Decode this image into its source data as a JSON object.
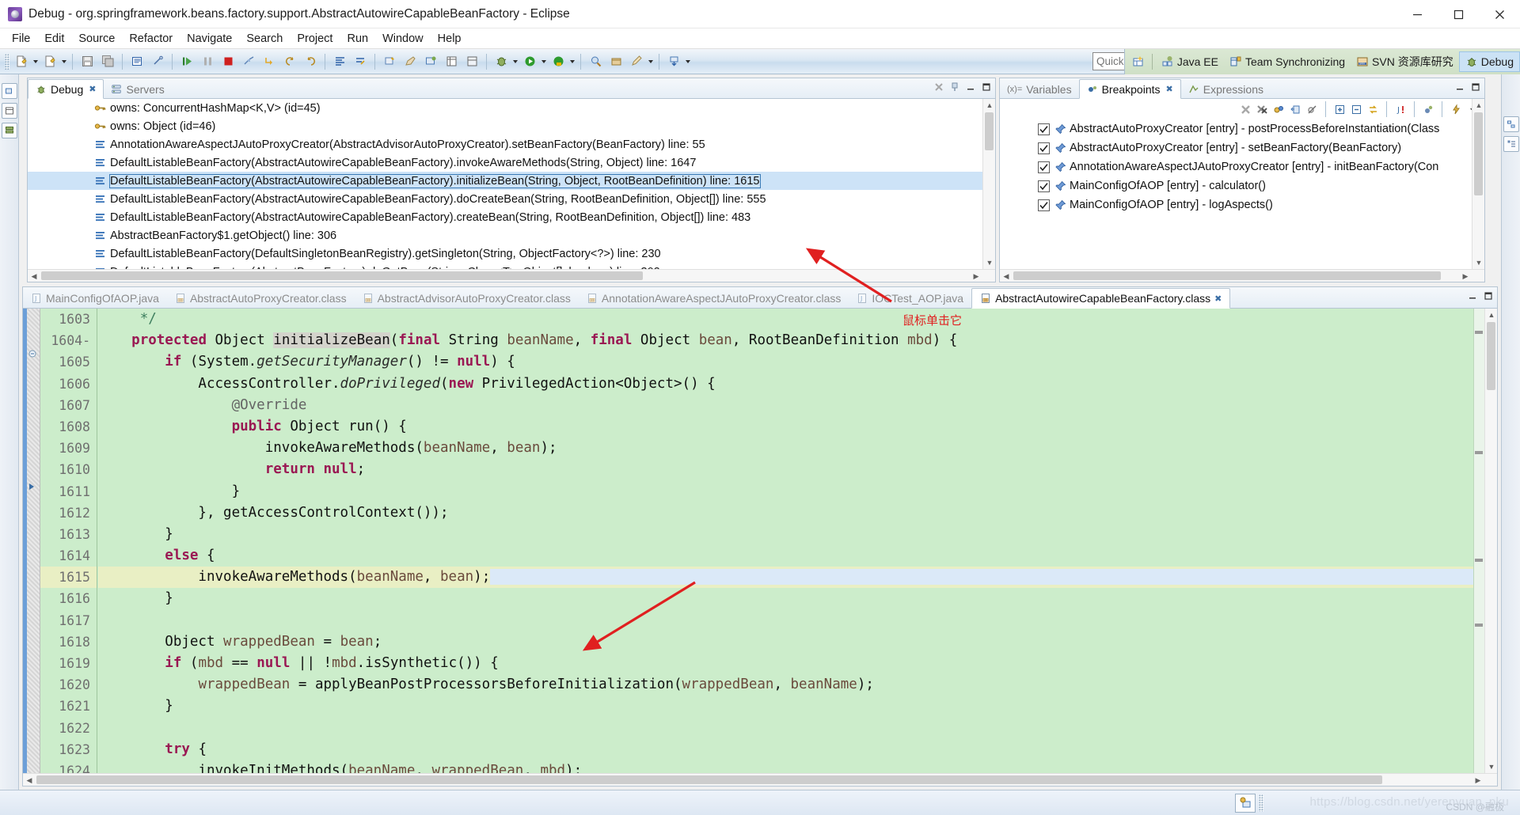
{
  "window": {
    "title": "Debug - org.springframework.beans.factory.support.AbstractAutowireCapableBeanFactory - Eclipse",
    "app_icon": "eclipse-icon",
    "minimize": "–",
    "maximize": "❐",
    "close": "✕"
  },
  "menubar": {
    "items": [
      "File",
      "Edit",
      "Source",
      "Refactor",
      "Navigate",
      "Search",
      "Project",
      "Run",
      "Window",
      "Help"
    ]
  },
  "toolbar": {
    "quick_access_placeholder": "Quick Access",
    "icons": [
      "new-file-icon",
      "new-wizard-icon",
      "save-icon",
      "save-all-icon",
      "print-icon",
      "link-icon",
      "resume-icon",
      "suspend-icon",
      "terminate-icon",
      "disconnect-icon",
      "step-return-icon",
      "step-into-icon",
      "step-over-icon",
      "align-icon",
      "skip-breakpoints-icon",
      "open-type-icon",
      "last-edit-icon",
      "external-tools-icon",
      "table-icon",
      "table2-icon",
      "debug-icon",
      "run-icon",
      "run-as-icon",
      "coverage-icon",
      "search-icon",
      "package-icon",
      "edit-icon",
      "download-icon"
    ]
  },
  "perspectives": {
    "open_perspective_icon": "open-perspective-icon",
    "items": [
      {
        "label": "Java EE",
        "icon": "javaee-perspective-icon",
        "active": false
      },
      {
        "label": "Team Synchronizing",
        "icon": "team-sync-perspective-icon",
        "active": false
      },
      {
        "label": "SVN 资源库研究",
        "icon": "svn-perspective-icon",
        "active": false
      },
      {
        "label": "Debug",
        "icon": "debug-perspective-icon",
        "active": true
      }
    ]
  },
  "debug_view": {
    "tabs": [
      {
        "label": "Debug",
        "icon": "debug-icon",
        "active": true,
        "closable": true
      },
      {
        "label": "Servers",
        "icon": "servers-icon",
        "active": false,
        "closable": false
      }
    ],
    "toolbar_icons": [
      "remove-all-terminated-icon",
      "pin-icon",
      "minimize-icon",
      "maximize-icon"
    ],
    "stack": [
      {
        "icon": "monitor-key-icon",
        "text": "owns: ConcurrentHashMap<K,V>  (id=45)",
        "selected": false
      },
      {
        "icon": "monitor-key-icon",
        "text": "owns: Object  (id=46)",
        "selected": false
      },
      {
        "icon": "stack-frame-icon",
        "text": "AnnotationAwareAspectJAutoProxyCreator(AbstractAdvisorAutoProxyCreator).setBeanFactory(BeanFactory) line: 55",
        "selected": false
      },
      {
        "icon": "stack-frame-icon",
        "text": "DefaultListableBeanFactory(AbstractAutowireCapableBeanFactory).invokeAwareMethods(String, Object) line: 1647",
        "selected": false
      },
      {
        "icon": "stack-frame-icon",
        "text": "DefaultListableBeanFactory(AbstractAutowireCapableBeanFactory).initializeBean(String, Object, RootBeanDefinition) line: 1615",
        "selected": true
      },
      {
        "icon": "stack-frame-icon",
        "text": "DefaultListableBeanFactory(AbstractAutowireCapableBeanFactory).doCreateBean(String, RootBeanDefinition, Object[]) line: 555",
        "selected": false
      },
      {
        "icon": "stack-frame-icon",
        "text": "DefaultListableBeanFactory(AbstractAutowireCapableBeanFactory).createBean(String, RootBeanDefinition, Object[]) line: 483",
        "selected": false
      },
      {
        "icon": "stack-frame-icon",
        "text": "AbstractBeanFactory$1.getObject() line: 306",
        "selected": false
      },
      {
        "icon": "stack-frame-icon",
        "text": "DefaultListableBeanFactory(DefaultSingletonBeanRegistry).getSingleton(String, ObjectFactory<?>) line: 230",
        "selected": false
      },
      {
        "icon": "stack-frame-icon",
        "text": "DefaultListableBeanFactory(AbstractBeanFactory).doGetBean(String, Class<T>, Object[], boolean) line: 302",
        "selected": false
      }
    ]
  },
  "breakpoints_view": {
    "tabs": [
      {
        "label": "Variables",
        "icon": "variables-icon",
        "active": false,
        "closable": false
      },
      {
        "label": "Breakpoints",
        "icon": "breakpoints-icon",
        "active": true,
        "closable": true
      },
      {
        "label": "Expressions",
        "icon": "expressions-icon",
        "active": false,
        "closable": false
      }
    ],
    "toolbar_icons": [
      "remove-breakpoint-icon",
      "remove-all-breakpoints-icon",
      "link-with-debug-view-icon",
      "goto-file-icon",
      "skip-all-breakpoints-icon",
      "expand-all-icon",
      "collapse-all-icon",
      "working-sets-icon",
      "add-java-exception-icon",
      "breakpoint-group-icon",
      "thunder-icon",
      "view-menu-icon"
    ],
    "minimize": "minimize-icon",
    "maximize": "maximize-icon",
    "items": [
      {
        "checked": true,
        "icon": "breakpoint-pin-icon",
        "text": "AbstractAutoProxyCreator [entry] - postProcessBeforeInstantiation(Class"
      },
      {
        "checked": true,
        "icon": "breakpoint-pin-icon",
        "text": "AbstractAutoProxyCreator [entry] - setBeanFactory(BeanFactory)"
      },
      {
        "checked": true,
        "icon": "breakpoint-pin-icon",
        "text": "AnnotationAwareAspectJAutoProxyCreator [entry] - initBeanFactory(Con"
      },
      {
        "checked": true,
        "icon": "breakpoint-pin-icon",
        "text": "MainConfigOfAOP [entry] - calculator()"
      },
      {
        "checked": true,
        "icon": "breakpoint-pin-icon",
        "text": "MainConfigOfAOP [entry] - logAspects()"
      }
    ]
  },
  "editor": {
    "tabs": [
      {
        "label": "MainConfigOfAOP.java",
        "icon": "java-file-icon",
        "active": false,
        "closable": false
      },
      {
        "label": "AbstractAutoProxyCreator.class",
        "icon": "class-file-icon",
        "active": false,
        "closable": false
      },
      {
        "label": "AbstractAdvisorAutoProxyCreator.class",
        "icon": "class-file-icon",
        "active": false,
        "closable": false
      },
      {
        "label": "AnnotationAwareAspectJAutoProxyCreator.class",
        "icon": "class-file-icon",
        "active": false,
        "closable": false
      },
      {
        "label": "IOCTest_AOP.java",
        "icon": "java-file-icon",
        "active": false,
        "closable": false
      },
      {
        "label": "AbstractAutowireCapableBeanFactory.class",
        "icon": "class-file-icon",
        "active": true,
        "closable": true
      }
    ],
    "minimize": "minimize-icon",
    "maximize": "maximize-icon",
    "first_line_number": 1603,
    "current_line_number": 1615,
    "code_lines": [
      {
        "num": 1603,
        "folding": "",
        "tokens": [
          {
            "t": "     ",
            "c": ""
          },
          {
            "t": "*/",
            "c": "cm"
          }
        ]
      },
      {
        "num": 1604,
        "folding": "-",
        "tokens": [
          {
            "t": "    ",
            "c": ""
          },
          {
            "t": "protected",
            "c": "kw"
          },
          {
            "t": " Object ",
            "c": ""
          },
          {
            "t": "initializeBean",
            "c": "hl-token"
          },
          {
            "t": "(",
            "c": ""
          },
          {
            "t": "final",
            "c": "kw"
          },
          {
            "t": " String ",
            "c": ""
          },
          {
            "t": "beanName",
            "c": "var"
          },
          {
            "t": ", ",
            "c": ""
          },
          {
            "t": "final",
            "c": "kw"
          },
          {
            "t": " Object ",
            "c": ""
          },
          {
            "t": "bean",
            "c": "var"
          },
          {
            "t": ", RootBeanDefinition ",
            "c": ""
          },
          {
            "t": "mbd",
            "c": "var"
          },
          {
            "t": ") {",
            "c": ""
          }
        ]
      },
      {
        "num": 1605,
        "folding": "",
        "tokens": [
          {
            "t": "        ",
            "c": ""
          },
          {
            "t": "if",
            "c": "kw"
          },
          {
            "t": " (System.",
            "c": ""
          },
          {
            "t": "getSecurityManager",
            "c": "mth"
          },
          {
            "t": "() != ",
            "c": ""
          },
          {
            "t": "null",
            "c": "kw"
          },
          {
            "t": ") {",
            "c": ""
          }
        ]
      },
      {
        "num": 1606,
        "folding": "",
        "tokens": [
          {
            "t": "            AccessController.",
            "c": ""
          },
          {
            "t": "doPrivileged",
            "c": "mth"
          },
          {
            "t": "(",
            "c": ""
          },
          {
            "t": "new",
            "c": "kw"
          },
          {
            "t": " PrivilegedAction<Object>() {",
            "c": ""
          }
        ]
      },
      {
        "num": 1607,
        "folding": "",
        "tokens": [
          {
            "t": "                ",
            "c": ""
          },
          {
            "t": "@Override",
            "c": "anno"
          }
        ]
      },
      {
        "num": 1608,
        "folding": "",
        "tokens": [
          {
            "t": "                ",
            "c": ""
          },
          {
            "t": "public",
            "c": "kw"
          },
          {
            "t": " Object run() {",
            "c": ""
          }
        ]
      },
      {
        "num": 1609,
        "folding": "",
        "tokens": [
          {
            "t": "                    invokeAwareMethods(",
            "c": ""
          },
          {
            "t": "beanName",
            "c": "var"
          },
          {
            "t": ", ",
            "c": ""
          },
          {
            "t": "bean",
            "c": "var"
          },
          {
            "t": ");",
            "c": ""
          }
        ]
      },
      {
        "num": 1610,
        "folding": "",
        "tokens": [
          {
            "t": "                    ",
            "c": ""
          },
          {
            "t": "return",
            "c": "kw"
          },
          {
            "t": " ",
            "c": ""
          },
          {
            "t": "null",
            "c": "kw"
          },
          {
            "t": ";",
            "c": ""
          }
        ]
      },
      {
        "num": 1611,
        "folding": "",
        "tokens": [
          {
            "t": "                }",
            "c": ""
          }
        ]
      },
      {
        "num": 1612,
        "folding": "",
        "tokens": [
          {
            "t": "            }, getAccessControlContext());",
            "c": ""
          }
        ]
      },
      {
        "num": 1613,
        "folding": "",
        "tokens": [
          {
            "t": "        }",
            "c": ""
          }
        ]
      },
      {
        "num": 1614,
        "folding": "",
        "tokens": [
          {
            "t": "        ",
            "c": ""
          },
          {
            "t": "else",
            "c": "kw"
          },
          {
            "t": " {",
            "c": ""
          }
        ]
      },
      {
        "num": 1615,
        "folding": "",
        "current": true,
        "tokens": [
          {
            "t": "            invokeAwareMethods(",
            "c": ""
          },
          {
            "t": "beanName",
            "c": "var"
          },
          {
            "t": ", ",
            "c": ""
          },
          {
            "t": "bean",
            "c": "var"
          },
          {
            "t": ");",
            "c": ""
          }
        ]
      },
      {
        "num": 1616,
        "folding": "",
        "tokens": [
          {
            "t": "        }",
            "c": ""
          }
        ]
      },
      {
        "num": 1617,
        "folding": "",
        "tokens": [
          {
            "t": "",
            "c": ""
          }
        ]
      },
      {
        "num": 1618,
        "folding": "",
        "tokens": [
          {
            "t": "        Object ",
            "c": ""
          },
          {
            "t": "wrappedBean",
            "c": "var"
          },
          {
            "t": " = ",
            "c": ""
          },
          {
            "t": "bean",
            "c": "var"
          },
          {
            "t": ";",
            "c": ""
          }
        ]
      },
      {
        "num": 1619,
        "folding": "",
        "tokens": [
          {
            "t": "        ",
            "c": ""
          },
          {
            "t": "if",
            "c": "kw"
          },
          {
            "t": " (",
            "c": ""
          },
          {
            "t": "mbd",
            "c": "var"
          },
          {
            "t": " == ",
            "c": ""
          },
          {
            "t": "null",
            "c": "kw"
          },
          {
            "t": " || !",
            "c": ""
          },
          {
            "t": "mbd",
            "c": "var"
          },
          {
            "t": ".isSynthetic()) {",
            "c": ""
          }
        ]
      },
      {
        "num": 1620,
        "folding": "",
        "tokens": [
          {
            "t": "            ",
            "c": ""
          },
          {
            "t": "wrappedBean",
            "c": "var"
          },
          {
            "t": " = applyBeanPostProcessorsBeforeInitialization(",
            "c": ""
          },
          {
            "t": "wrappedBean",
            "c": "var"
          },
          {
            "t": ", ",
            "c": ""
          },
          {
            "t": "beanName",
            "c": "var"
          },
          {
            "t": ");",
            "c": ""
          }
        ]
      },
      {
        "num": 1621,
        "folding": "",
        "tokens": [
          {
            "t": "        }",
            "c": ""
          }
        ]
      },
      {
        "num": 1622,
        "folding": "",
        "tokens": [
          {
            "t": "",
            "c": ""
          }
        ]
      },
      {
        "num": 1623,
        "folding": "",
        "tokens": [
          {
            "t": "        ",
            "c": ""
          },
          {
            "t": "try",
            "c": "kw"
          },
          {
            "t": " {",
            "c": ""
          }
        ]
      },
      {
        "num": 1624,
        "folding": "",
        "tokens": [
          {
            "t": "            invokeInitMethods(",
            "c": ""
          },
          {
            "t": "beanName",
            "c": "var"
          },
          {
            "t": ", ",
            "c": ""
          },
          {
            "t": "wrappedBean",
            "c": "var"
          },
          {
            "t": ", ",
            "c": ""
          },
          {
            "t": "mbd",
            "c": "var"
          },
          {
            "t": ");",
            "c": ""
          }
        ]
      }
    ]
  },
  "annotations": [
    {
      "name": "click-hint",
      "text": "鼠标单击它",
      "color": "#e02020"
    }
  ],
  "statusbar": {
    "icon": "remote-systems-icon",
    "watermark": "https://blog.csdn.net/yerenyuan_pku",
    "watermark2": "CSDN @融极"
  },
  "colors": {
    "editor_background": "#ccedcb",
    "current_line": "#e9efc4",
    "selection": "#cde3f7",
    "keyword": "#9a1853",
    "comment": "#3f7f5f",
    "annotation_red": "#e02020",
    "perspective_active": "#cbe2f5"
  }
}
